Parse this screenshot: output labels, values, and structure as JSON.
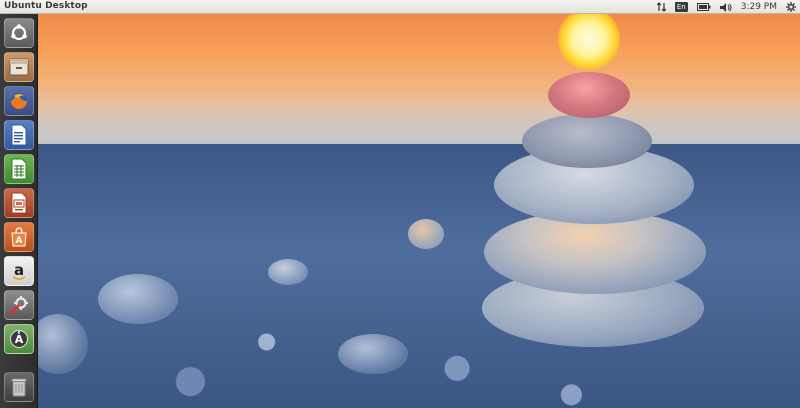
{
  "panel": {
    "title": "Ubuntu Desktop",
    "keyboard_layout": "En",
    "clock": "3:29 PM"
  },
  "launcher": {
    "items": [
      {
        "name": "dash-home",
        "icon": "ubuntu-logo-icon"
      },
      {
        "name": "files",
        "icon": "file-cabinet-icon"
      },
      {
        "name": "firefox",
        "icon": "firefox-icon"
      },
      {
        "name": "libreoffice-writer",
        "icon": "writer-document-icon"
      },
      {
        "name": "libreoffice-calc",
        "icon": "calc-spreadsheet-icon"
      },
      {
        "name": "libreoffice-impress",
        "icon": "impress-presentation-icon"
      },
      {
        "name": "ubuntu-software-center",
        "icon": "software-center-bag-icon"
      },
      {
        "name": "amazon",
        "icon": "amazon-icon"
      },
      {
        "name": "system-settings",
        "icon": "system-settings-icon"
      },
      {
        "name": "software-updater",
        "icon": "updater-icon"
      },
      {
        "name": "trash",
        "icon": "trash-icon"
      }
    ]
  },
  "indicators": {
    "network": "network-arrows-icon",
    "battery": "battery-icon",
    "sound": "speaker-icon",
    "session": "gear-icon"
  },
  "colors": {
    "panel_bg": "#e8e6e1",
    "launcher_bg": "#333333",
    "sky_orange": "#f28a4a",
    "sea_blue": "#3f5e8f"
  }
}
